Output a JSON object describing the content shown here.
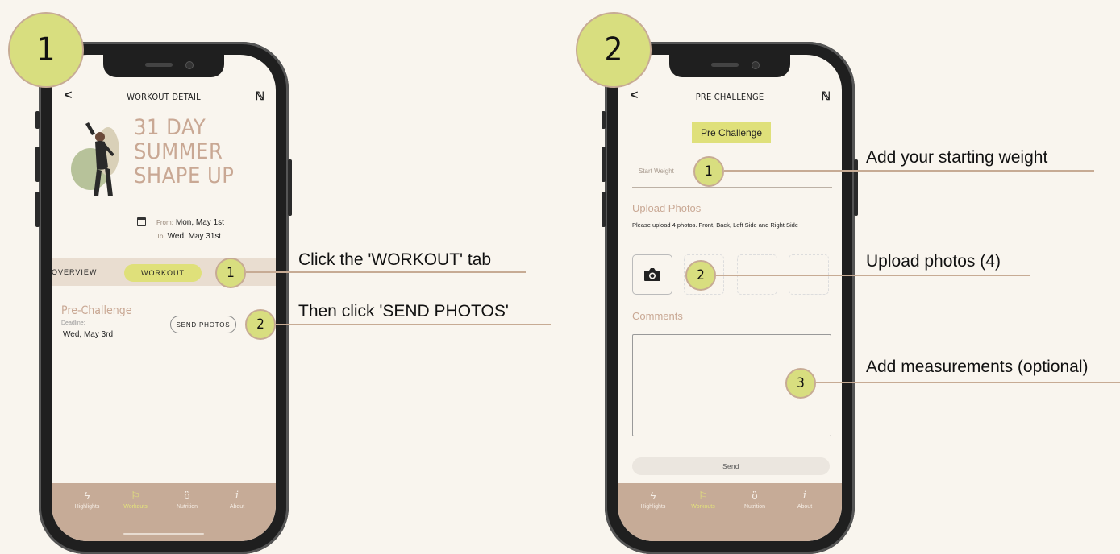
{
  "colors": {
    "background": "#f9f5ee",
    "accent": "#dfe07a",
    "tan": "#c6ab97",
    "title": "#c9a894"
  },
  "steps": {
    "step1": "1",
    "step2": "2"
  },
  "screen1": {
    "back": "<",
    "title": "WORKOUT DETAIL",
    "logo": "ℕ",
    "hero_title": [
      "31 DAY",
      "SUMMER",
      "SHAPE UP"
    ],
    "from_label": "From:",
    "from_date": "Mon, May 1st",
    "to_label": "To:",
    "to_date": "Wed, May 31st",
    "tab_overview": "OVERVIEW",
    "tab_workout": "WORKOUT",
    "pc_title": "Pre-Challenge",
    "deadline_label": "Deadline:",
    "deadline_date": "Wed, May 3rd",
    "send_photos": "SEND PHOTOS"
  },
  "screen2": {
    "back": "<",
    "title": "PRE CHALLENGE",
    "logo": "ℕ",
    "badge": "Pre Challenge",
    "start_weight_placeholder": "Start Weight",
    "upload_title": "Upload Photos",
    "upload_desc": "Please upload 4 photos. Front, Back, Left Side and Right Side",
    "comments_title": "Comments",
    "send": "Send"
  },
  "nav": [
    {
      "label": "Highlights",
      "icon": "lightning-icon"
    },
    {
      "label": "Workouts",
      "icon": "flag-icon"
    },
    {
      "label": "Nutrition",
      "icon": "apple-icon"
    },
    {
      "label": "About",
      "icon": "info-icon"
    }
  ],
  "annotations": {
    "s1_m1": "1",
    "s1_m1_text": "Click the 'WORKOUT' tab",
    "s1_m2": "2",
    "s1_m2_text": "Then click 'SEND PHOTOS'",
    "s2_m1": "1",
    "s2_m1_text": "Add your starting weight",
    "s2_m2": "2",
    "s2_m2_text": "Upload photos (4)",
    "s2_m3": "3",
    "s2_m3_text": "Add measurements (optional)"
  }
}
